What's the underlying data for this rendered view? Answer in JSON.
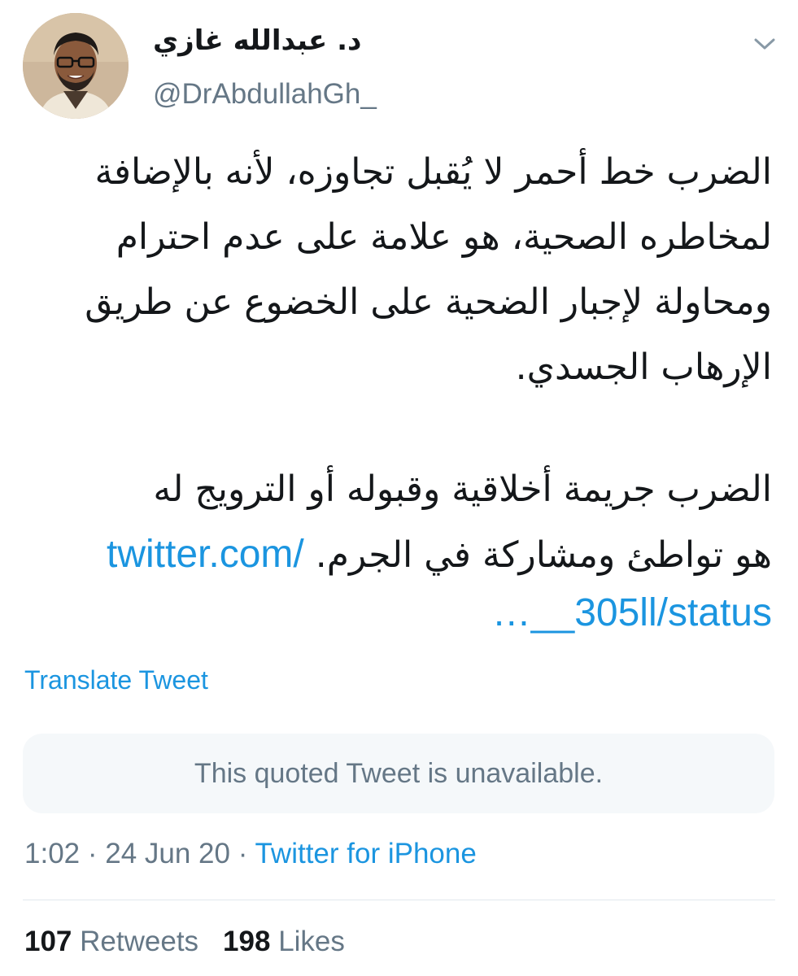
{
  "author": {
    "display_name": "د. عبدالله غازي",
    "handle": "@DrAbdullahGh_"
  },
  "tweet": {
    "lines": [
      "الضرب خط أحمر لا يُقبل تجاوزه، لأنه بالإضافة",
      "لمخاطره الصحية، هو علامة على عدم احترام",
      "ومحاولة لإجبار الضحية على الخضوع عن طريق",
      "الإرهاب الجسدي.",
      "الضرب جريمة أخلاقية وقبوله أو الترويج له",
      "هو تواطئ ومشاركة في الجرم."
    ],
    "link_part1": "twitter.com/",
    "link_part2": "…__305ll/status"
  },
  "translate_label": "Translate Tweet",
  "quoted_tweet": {
    "message": "This quoted Tweet is unavailable."
  },
  "meta": {
    "time": "1:02",
    "separator": " · ",
    "date": "24 Jun 20",
    "source": "Twitter for iPhone"
  },
  "stats": {
    "retweets_count": "107",
    "retweets_label": "Retweets",
    "likes_count": "198",
    "likes_label": "Likes"
  },
  "colors": {
    "link": "#1b95e0",
    "secondary_text": "#657786",
    "primary_text": "#14171a",
    "quoted_bg": "#f5f8fa"
  },
  "icons": {
    "caret": "chevron-down-icon"
  }
}
